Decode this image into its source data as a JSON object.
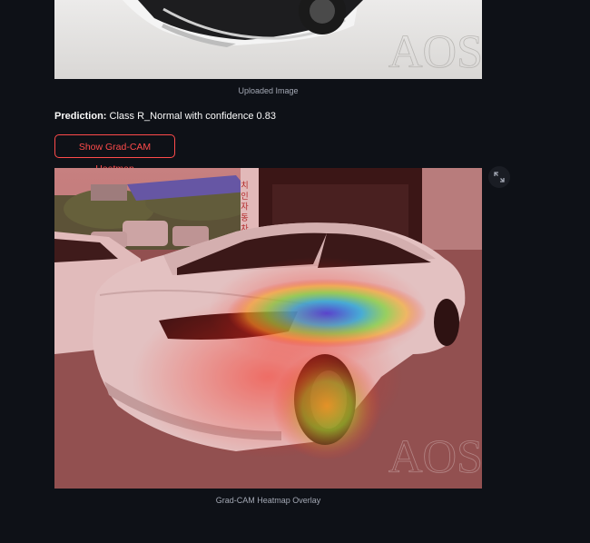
{
  "uploaded_image": {
    "caption": "Uploaded Image",
    "watermark": "AOS"
  },
  "prediction": {
    "label": "Prediction:",
    "text": "Class R_Normal with confidence 0.83"
  },
  "heatmap_button": {
    "label": "Show Grad-CAM Heatmap"
  },
  "heatmap_image": {
    "caption": "Grad-CAM Heatmap Overlay",
    "watermark": "AOS",
    "sign_text": "치 인 자 동 차"
  },
  "icons": {
    "fullscreen": "expand-icon"
  },
  "colors": {
    "background": "#0e1117",
    "accent": "#ff4b4b",
    "caption": "#a3a8b4"
  }
}
